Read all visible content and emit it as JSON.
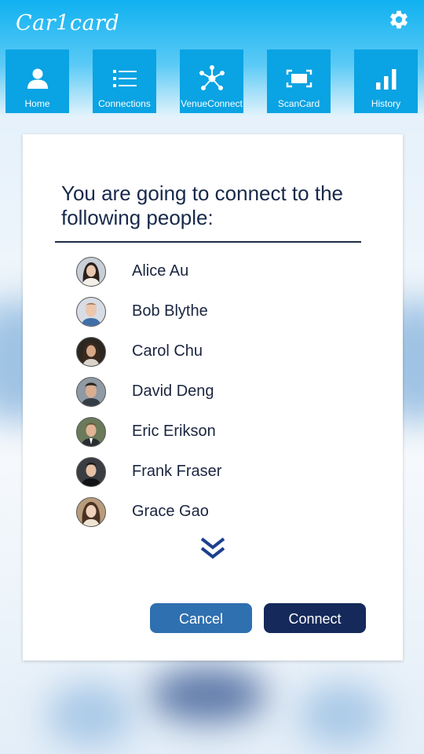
{
  "app": {
    "logo_text": "Car1card"
  },
  "nav": {
    "items": [
      {
        "label": "Home",
        "icon": "person-icon"
      },
      {
        "label": "Connections",
        "icon": "list-icon"
      },
      {
        "label": "VenueConnect",
        "icon": "network-icon"
      },
      {
        "label": "ScanCard",
        "icon": "scan-frame-icon"
      },
      {
        "label": "History",
        "icon": "bar-chart-icon"
      }
    ]
  },
  "dialog": {
    "heading": "You are going to connect to the following people:",
    "people": [
      {
        "name": "Alice Au"
      },
      {
        "name": "Bob Blythe"
      },
      {
        "name": "Carol Chu"
      },
      {
        "name": "David Deng"
      },
      {
        "name": "Eric Erikson"
      },
      {
        "name": "Frank Fraser"
      },
      {
        "name": "Grace Gao"
      }
    ],
    "cancel_label": "Cancel",
    "connect_label": "Connect"
  },
  "colors": {
    "header_top": "#0fb1f0",
    "nav_tile": "#0aa3e3",
    "heading_text": "#18294a",
    "cancel_button": "#2f70b0",
    "connect_button": "#15295a"
  }
}
